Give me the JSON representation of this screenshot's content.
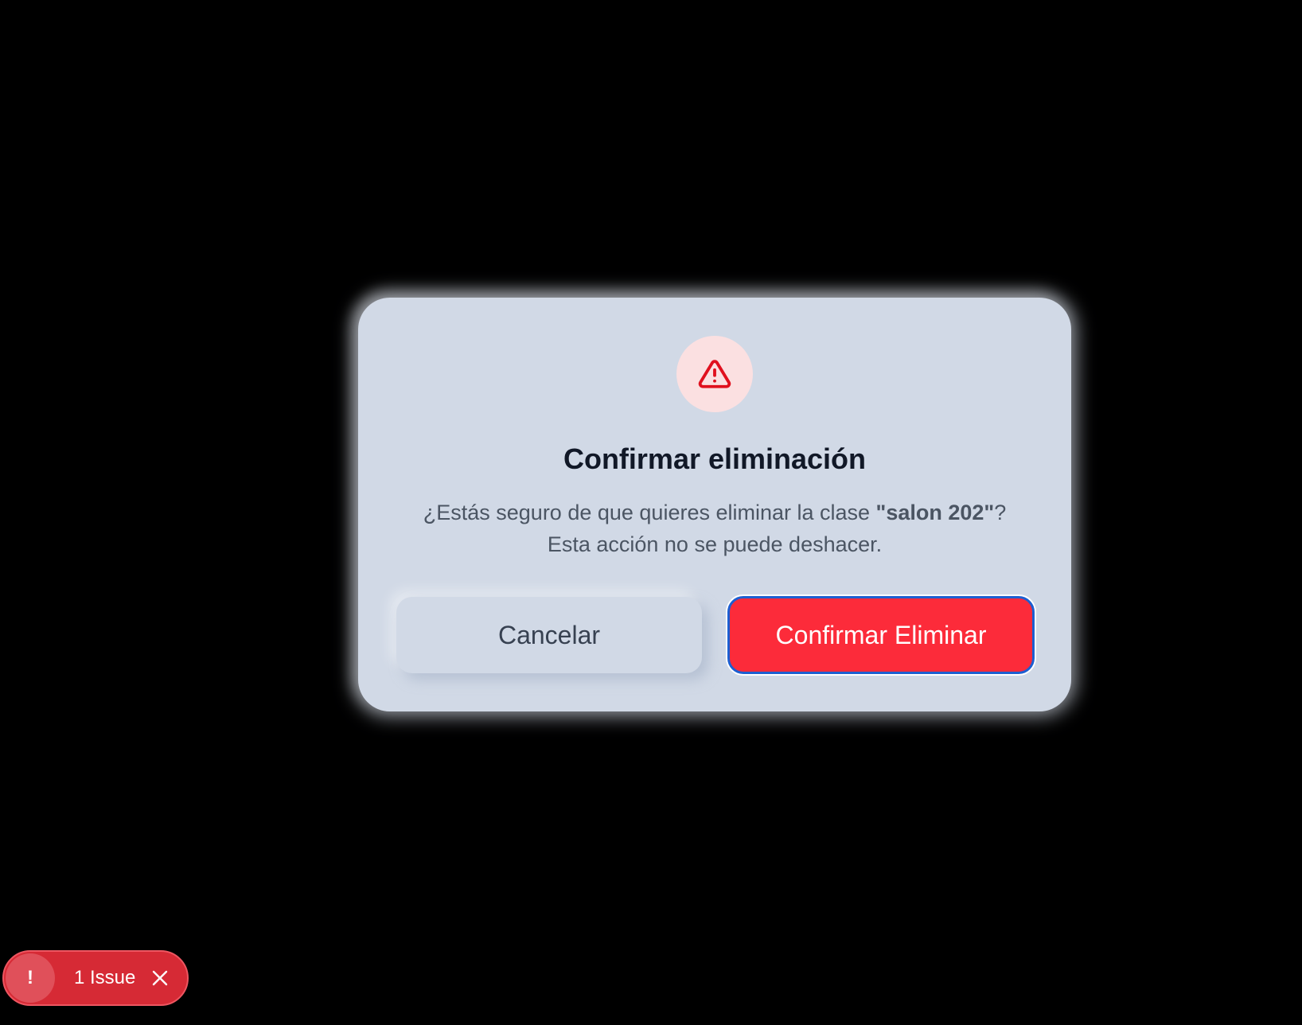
{
  "dialog": {
    "title": "Confirmar eliminación",
    "message_before": "¿Estás seguro de que quieres eliminar la clase ",
    "item_name": "\"salon 202\"",
    "message_after": "?",
    "message_line2": "Esta acción no se puede deshacer.",
    "cancel_label": "Cancelar",
    "confirm_label": "Confirmar Eliminar",
    "icon": "warning-triangle-icon",
    "accent_color": "#fc2b3a"
  },
  "issues_badge": {
    "icon_glyph": "!",
    "label": "1 Issue",
    "close_icon": "close-icon"
  }
}
